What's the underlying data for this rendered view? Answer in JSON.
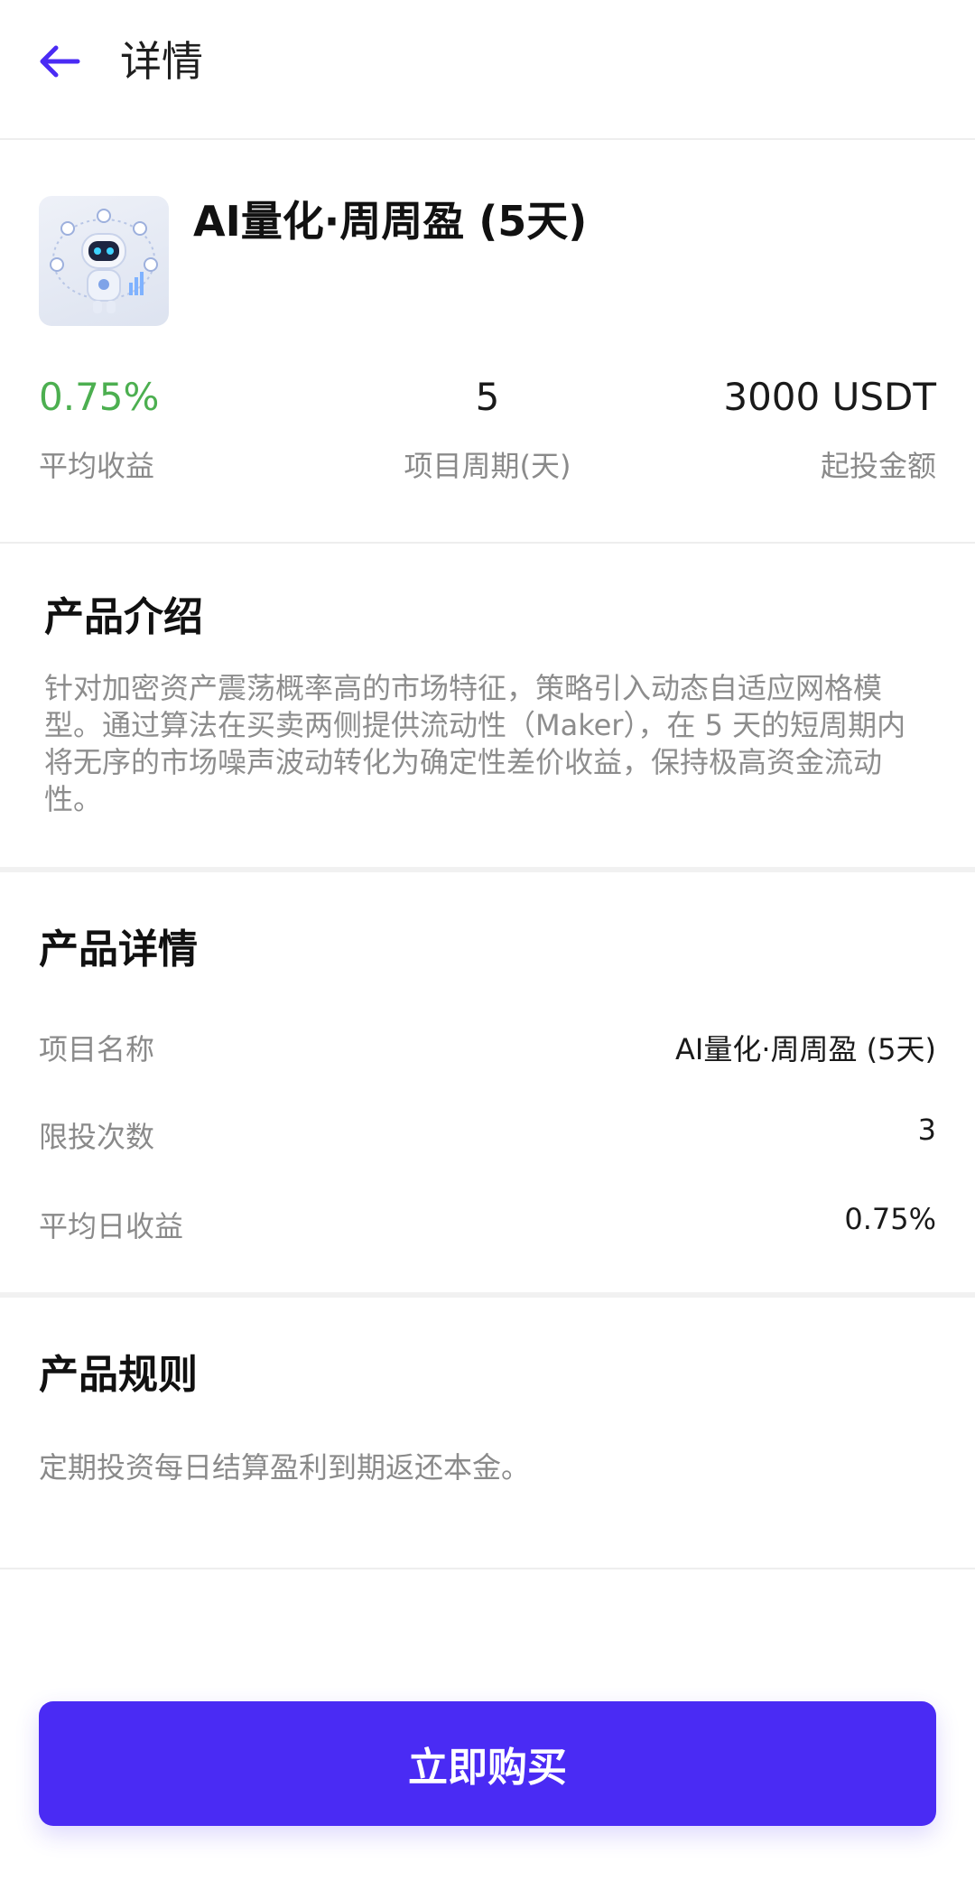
{
  "header": {
    "title": "详情",
    "back_icon": "arrow-left-icon",
    "accent_color": "#4a2bf4"
  },
  "product": {
    "name": "AI量化·周周盈 (5天)",
    "thumbnail_icon": "robot-icon",
    "stats": [
      {
        "value": "0.75%",
        "label": "平均收益",
        "color": "#4caf50"
      },
      {
        "value": "5",
        "label": "项目周期(天)"
      },
      {
        "value": "3000 USDT",
        "label": "起投金额"
      }
    ]
  },
  "intro": {
    "title": "产品介绍",
    "text": "针对加密资产震荡概率高的市场特征，策略引入动态自适应网格模型。通过算法在买卖两侧提供流动性（Maker），在 5 天的短周期内将无序的市场噪声波动转化为确定性差价收益，保持极高资金流动性。"
  },
  "details": {
    "title": "产品详情",
    "rows": [
      {
        "key": "项目名称",
        "value": "AI量化·周周盈 (5天)"
      },
      {
        "key": "限投次数",
        "value": "3"
      },
      {
        "key": "平均日收益",
        "value": "0.75%",
        "color": "#4caf50"
      }
    ]
  },
  "rules": {
    "title": "产品规则",
    "text": "定期投资每日结算盈利到期返还本金。"
  },
  "buy_button": {
    "label": "立即购买",
    "color": "#4a2bf4"
  }
}
